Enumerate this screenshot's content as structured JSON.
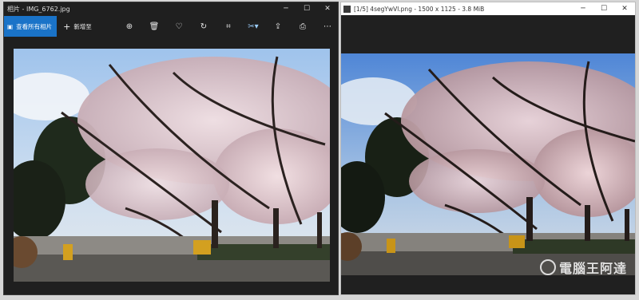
{
  "left_window": {
    "title": "相片 - IMG_6762.jpg",
    "controls": {
      "minimize": "─",
      "maximize": "☐",
      "close": "✕"
    },
    "toolbar": {
      "view_all_label": "查看所有相片",
      "add_to_label": "新增至",
      "icons": [
        "zoom-in-icon",
        "delete-icon",
        "favorite-icon",
        "rotate-icon",
        "crop-icon",
        "edit-icon",
        "share-icon",
        "print-icon",
        "more-icon"
      ]
    }
  },
  "right_window": {
    "title": "[1/5] 4segYwVl.png - 1500 x 1125 - 3.8 MiB",
    "controls": {
      "minimize": "─",
      "maximize": "☐",
      "close": "✕"
    }
  },
  "watermark": {
    "text": "電腦王阿達"
  }
}
